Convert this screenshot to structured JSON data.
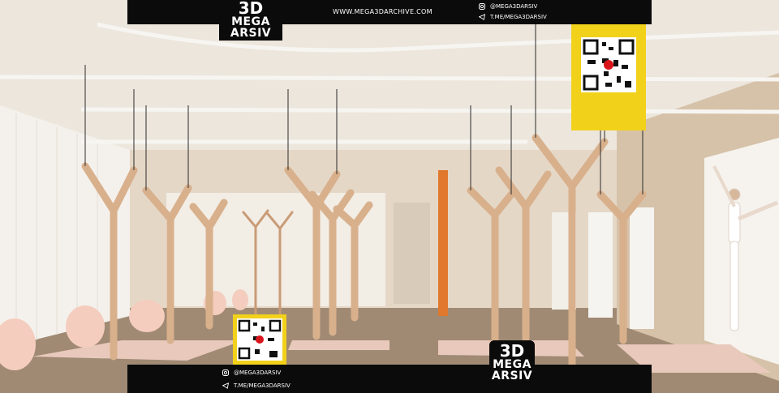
{
  "top_bar": {
    "url": "WWW.MEGA3DARCHIVE.COM",
    "instagram": "@MEGA3DARSIV",
    "telegram": "T.ME/MEGA3DARSIV"
  },
  "logo": {
    "line1": "3D",
    "line2": "MEGA",
    "line3": "ARSIV"
  },
  "bottom_bar": {
    "instagram": "@MEGA3DARSIV",
    "telegram": "T.ME/MEGA3DARSIV"
  },
  "icons": [
    "instagram-icon",
    "telegram-icon",
    "qr-code-icon"
  ],
  "colors": {
    "bar": "#0b0b0b",
    "qr_yellow": "#f2d11a",
    "qr_red": "#d9141b",
    "wall": "#e9dccb",
    "floor": "#a08a74",
    "wood": "#d8b08c",
    "orange_shelf": "#e0782e",
    "ball": "#f4cdbf"
  }
}
